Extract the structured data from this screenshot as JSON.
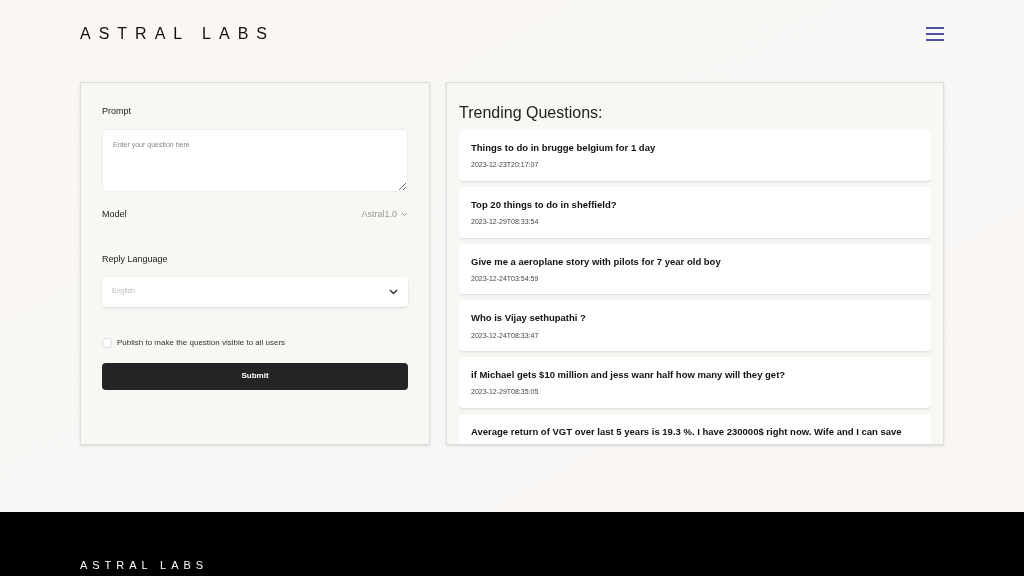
{
  "header": {
    "logo": "ASTRAL LABS"
  },
  "form": {
    "prompt_label": "Prompt",
    "prompt_placeholder": "Enter your question here",
    "model_label": "Model",
    "model_value": "Astral1.0",
    "language_label": "Reply Language",
    "language_placeholder": "English",
    "publish": {
      "label": "Publish to make the question visible to all users",
      "checked": false
    },
    "submit": "Submit"
  },
  "trending": {
    "title": "Trending Questions:",
    "items": [
      {
        "question": "Things to do in brugge belgium for 1 day",
        "time": "2023-12-23T20:17:07"
      },
      {
        "question": "Top 20 things to do in sheffield?",
        "time": "2023-12-29T08:33:54"
      },
      {
        "question": "Give me a aeroplane story with pilots for 7 year old boy",
        "time": "2023-12-24T03:54:59"
      },
      {
        "question": "Who is Vijay sethupathi ?",
        "time": "2023-12-24T08:33:47"
      },
      {
        "question": "if Michael gets $10 million and jess wanr half how many will they get?",
        "time": "2023-12-29T08:35:05"
      },
      {
        "question": "Average return of VGT over last 5 years is 19.3 %. I have 230000$ right now. Wife and I can save"
      }
    ]
  },
  "footer": {
    "logo": "ASTRAL LABS"
  }
}
